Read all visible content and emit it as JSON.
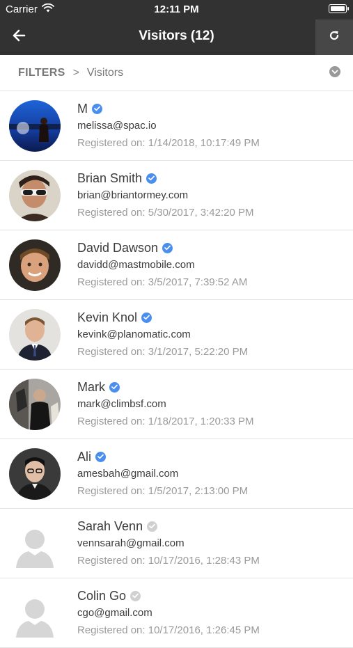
{
  "status": {
    "carrier": "Carrier",
    "time": "12:11 PM"
  },
  "nav": {
    "title": "Visitors (12)"
  },
  "filters": {
    "label": "FILTERS",
    "separator": ">",
    "crumb": "Visitors"
  },
  "visitors": [
    {
      "name": "M",
      "email": "melissa@spac.io",
      "registered": "Registered on: 1/14/2018, 10:17:49 PM",
      "verified": true,
      "avatar": "photo"
    },
    {
      "name": "Brian Smith",
      "email": "brian@briantormey.com",
      "registered": "Registered on: 5/30/2017, 3:42:20 PM",
      "verified": true,
      "avatar": "photo"
    },
    {
      "name": "David Dawson",
      "email": "davidd@mastmobile.com",
      "registered": "Registered on: 3/5/2017, 7:39:52 AM",
      "verified": true,
      "avatar": "photo"
    },
    {
      "name": "Kevin Knol",
      "email": "kevink@planomatic.com",
      "registered": "Registered on: 3/1/2017, 5:22:20 PM",
      "verified": true,
      "avatar": "photo"
    },
    {
      "name": "Mark",
      "email": "mark@climbsf.com",
      "registered": "Registered on: 1/18/2017, 1:20:33 PM",
      "verified": true,
      "avatar": "photo"
    },
    {
      "name": "Ali",
      "email": "amesbah@gmail.com",
      "registered": "Registered on: 1/5/2017, 2:13:00 PM",
      "verified": true,
      "avatar": "photo"
    },
    {
      "name": "Sarah Venn",
      "email": "vennsarah@gmail.com",
      "registered": "Registered on: 10/17/2016, 1:28:43 PM",
      "verified": false,
      "avatar": "placeholder"
    },
    {
      "name": "Colin Go",
      "email": "cgo@gmail.com",
      "registered": "Registered on: 10/17/2016, 1:26:45 PM",
      "verified": false,
      "avatar": "placeholder"
    }
  ],
  "colors": {
    "nav_bg": "#323232",
    "refresh_bg": "#474747",
    "verified": "#4a8ef0",
    "unverified": "#d0d0d0"
  },
  "icons": {
    "back": "arrow-left-icon",
    "refresh": "refresh-icon",
    "dropdown": "chevron-down-circle-icon",
    "check": "check-badge-icon"
  }
}
